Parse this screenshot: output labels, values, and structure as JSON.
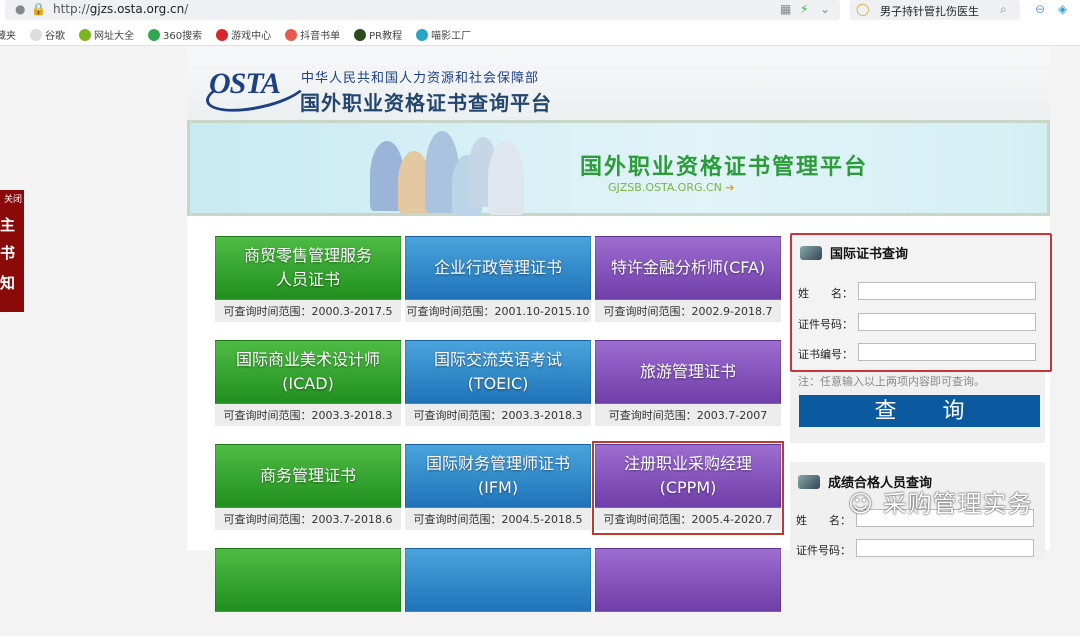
{
  "browser": {
    "url_prefix": "http://",
    "url_host": "gjzs.osta.org.cn",
    "url_suffix": "/",
    "search_text": "男子持针管扎伤医生"
  },
  "bookmarks": [
    {
      "label": "藏夹",
      "color": "#fff"
    },
    {
      "label": "谷歌",
      "color": "#ddd"
    },
    {
      "label": "网址大全",
      "color": "#7bb51e"
    },
    {
      "label": "360搜索",
      "color": "#2fa84f"
    },
    {
      "label": "游戏中心",
      "color": "#d6262c"
    },
    {
      "label": "抖音书单",
      "color": "#e85a4f"
    },
    {
      "label": "PR教程",
      "color": "#2d4a1d"
    },
    {
      "label": "喵影工厂",
      "color": "#2aa3c4"
    }
  ],
  "side": {
    "close": "关闭",
    "chars": [
      "主",
      "书",
      "知"
    ]
  },
  "header": {
    "logo": "OSTA",
    "ministry": "中华人民共和国人力资源和社会保障部",
    "title": "国外职业资格证书查询平台"
  },
  "banner": {
    "title": "国外职业资格证书管理平台",
    "url": "GJZSB.OSTA.ORG.CN"
  },
  "range_label": "可查询时间范围：",
  "tiles": [
    {
      "name": "商贸零售管理服务\n人员证书",
      "range": "2000.3-2017.5",
      "color": "green"
    },
    {
      "name": "企业行政管理证书",
      "range": "2001.10-2015.10",
      "color": "blue"
    },
    {
      "name": "特许金融分析师(CFA)",
      "range": "2002.9-2018.7",
      "color": "purple"
    },
    {
      "name": "国际商业美术设计师\n(ICAD)",
      "range": "2003.3-2018.3",
      "color": "green"
    },
    {
      "name": "国际交流英语考试\n(TOEIC)",
      "range": "2003.3-2018.3",
      "color": "blue"
    },
    {
      "name": "旅游管理证书",
      "range": "2003.7-2007",
      "color": "purple"
    },
    {
      "name": "商务管理证书",
      "range": "2003.7-2018.6",
      "color": "green"
    },
    {
      "name": "国际财务管理师证书\n(IFM)",
      "range": "2004.5-2018.5",
      "color": "blue"
    },
    {
      "name": "注册职业采购经理\n(CPPM)",
      "range": "2005.4-2020.7",
      "color": "purple",
      "highlighted": true
    }
  ],
  "cert_query": {
    "title": "国际证书查询",
    "name_label": "姓　　名：",
    "id_label": "证件号码：",
    "cert_label": "证书编号：",
    "note": "注：任意输入以上两项内容即可查询。",
    "button": "查 询"
  },
  "score_query": {
    "title": "成绩合格人员查询",
    "name_label": "姓　　名：",
    "id_label": "证件号码："
  },
  "watermark": "采购管理实务"
}
